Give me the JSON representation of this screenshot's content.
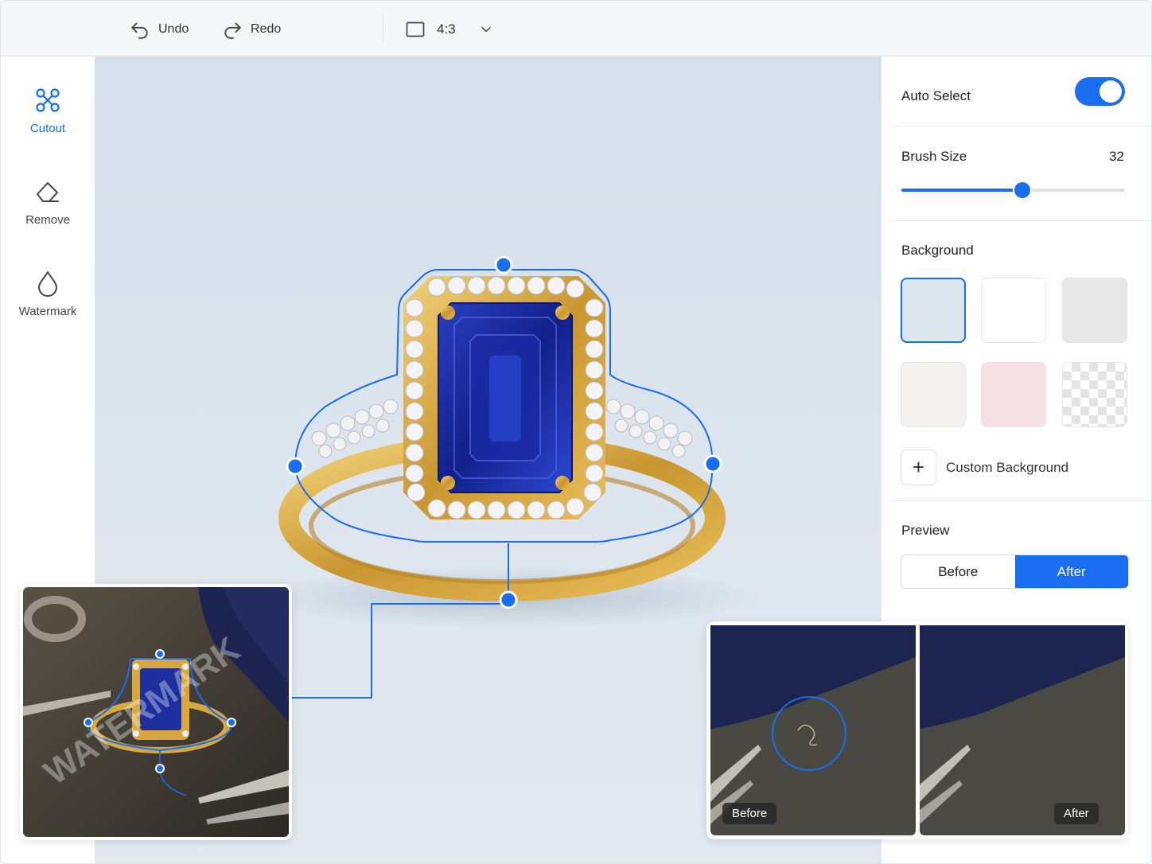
{
  "toolbar": {
    "undo_label": "Undo",
    "redo_label": "Redo",
    "aspect_ratio": "4:3"
  },
  "tools": [
    {
      "label": "Cutout",
      "icon": "scissors-icon",
      "active": true
    },
    {
      "label": "Remove",
      "icon": "eraser-icon",
      "active": false
    },
    {
      "label": "Watermark",
      "icon": "droplet-icon",
      "active": false
    }
  ],
  "panel": {
    "auto_select_label": "Auto Select",
    "auto_select_on": true,
    "brush_size_label": "Brush Size",
    "brush_size_value": "32",
    "brush_size_fraction": 0.54,
    "background_label": "Background",
    "swatches": [
      {
        "color": "#dde5ef",
        "selected": true
      },
      {
        "color": "#ffffff",
        "selected": false
      },
      {
        "color": "#e8e8e9",
        "selected": false
      },
      {
        "color": "#f3f2ee",
        "selected": false
      },
      {
        "color": "#f5e1e5",
        "selected": false
      },
      {
        "color": "transparent",
        "selected": false
      }
    ],
    "custom_background_label": "Custom Background",
    "preview_label": "Preview",
    "preview_before": "Before",
    "preview_after": "After"
  },
  "inset_left": {
    "watermark_text": "WATERMARK"
  },
  "inset_right": {
    "before_tag": "Before",
    "after_tag": "After"
  },
  "colors": {
    "accent": "#1a6cf0",
    "gold": "#d6a83f",
    "sapphire": "#1d2f9e"
  }
}
